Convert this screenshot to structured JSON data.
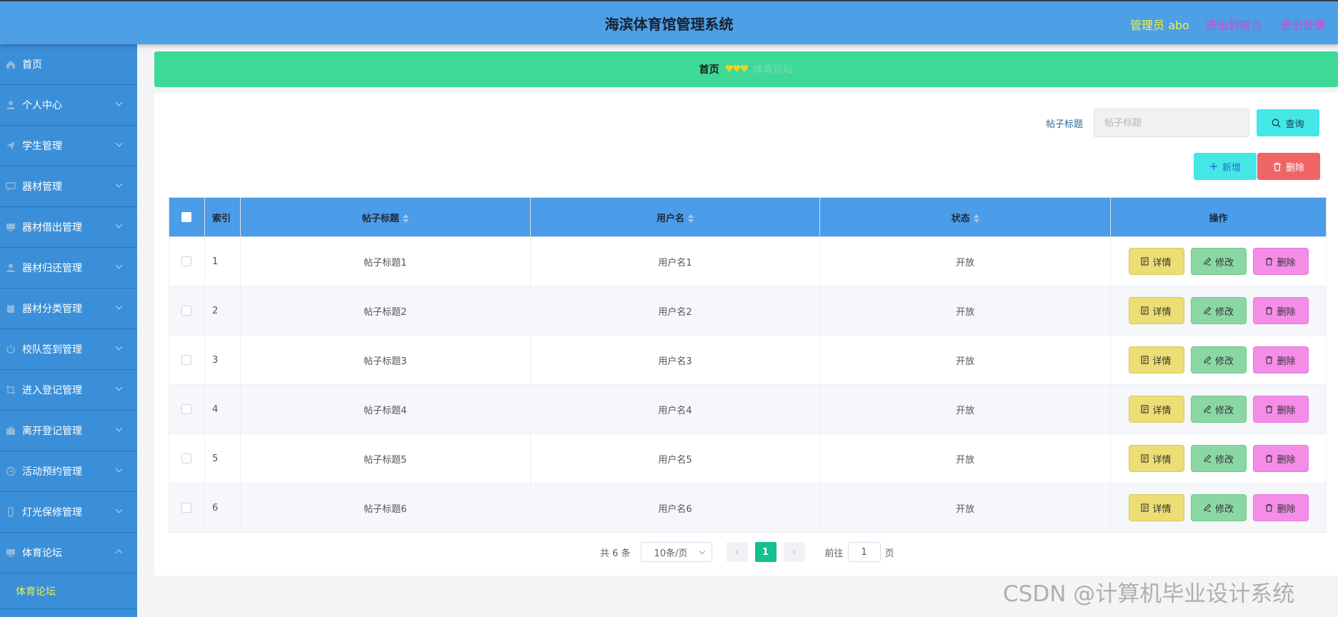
{
  "header": {
    "title": "海滨体育馆管理系统",
    "admin_text": "管理员 abo",
    "to_front": "退出到前台",
    "logout": "退出登录"
  },
  "sidebar": {
    "items": [
      {
        "label": "首页",
        "icon": "home-icon"
      },
      {
        "label": "个人中心",
        "icon": "user-icon"
      },
      {
        "label": "学生管理",
        "icon": "send-icon"
      },
      {
        "label": "器材管理",
        "icon": "chat-icon"
      },
      {
        "label": "器材借出管理",
        "icon": "monitor-icon"
      },
      {
        "label": "器材归还管理",
        "icon": "user-icon"
      },
      {
        "label": "器材分类管理",
        "icon": "clipboard-icon"
      },
      {
        "label": "校队签到管理",
        "icon": "power-icon"
      },
      {
        "label": "进入登记管理",
        "icon": "crop-icon"
      },
      {
        "label": "离开登记管理",
        "icon": "briefcase-icon"
      },
      {
        "label": "活动预约管理",
        "icon": "clock-icon"
      },
      {
        "label": "灯光保修管理",
        "icon": "phone-icon"
      },
      {
        "label": "体育论坛",
        "icon": "monitor-icon"
      }
    ],
    "sub_active": "体育论坛"
  },
  "breadcrumb": {
    "home": "首页",
    "separator": "♥♥♥",
    "current": "体育论坛"
  },
  "search": {
    "label": "帖子标题",
    "placeholder": "帖子标题",
    "query_label": "查询"
  },
  "actions": {
    "add_label": "新增",
    "delete_label": "删除"
  },
  "table": {
    "columns": [
      "索引",
      "帖子标题",
      "用户名",
      "状态",
      "操作"
    ],
    "rows": [
      {
        "index": "1",
        "title": "帖子标题1",
        "user": "用户名1",
        "status": "开放"
      },
      {
        "index": "2",
        "title": "帖子标题2",
        "user": "用户名2",
        "status": "开放"
      },
      {
        "index": "3",
        "title": "帖子标题3",
        "user": "用户名3",
        "status": "开放"
      },
      {
        "index": "4",
        "title": "帖子标题4",
        "user": "用户名4",
        "status": "开放"
      },
      {
        "index": "5",
        "title": "帖子标题5",
        "user": "用户名5",
        "status": "开放"
      },
      {
        "index": "6",
        "title": "帖子标题6",
        "user": "用户名6",
        "status": "开放"
      }
    ],
    "op_detail": "详情",
    "op_edit": "修改",
    "op_delete": "删除"
  },
  "pagination": {
    "total": "共 6 条",
    "page_size": "10条/页",
    "current_page": "1",
    "goto_prefix": "前往",
    "goto_value": "1",
    "goto_suffix": "页"
  },
  "watermark": "CSDN @计算机毕业设计系统",
  "colors": {
    "header_bg": "#4d9fe6",
    "sidebar_bg": "#3a8fd8",
    "breadcrumb_bg": "#3ed897",
    "table_header_bg": "#4b9ce9",
    "active_page": "#13c08e"
  }
}
